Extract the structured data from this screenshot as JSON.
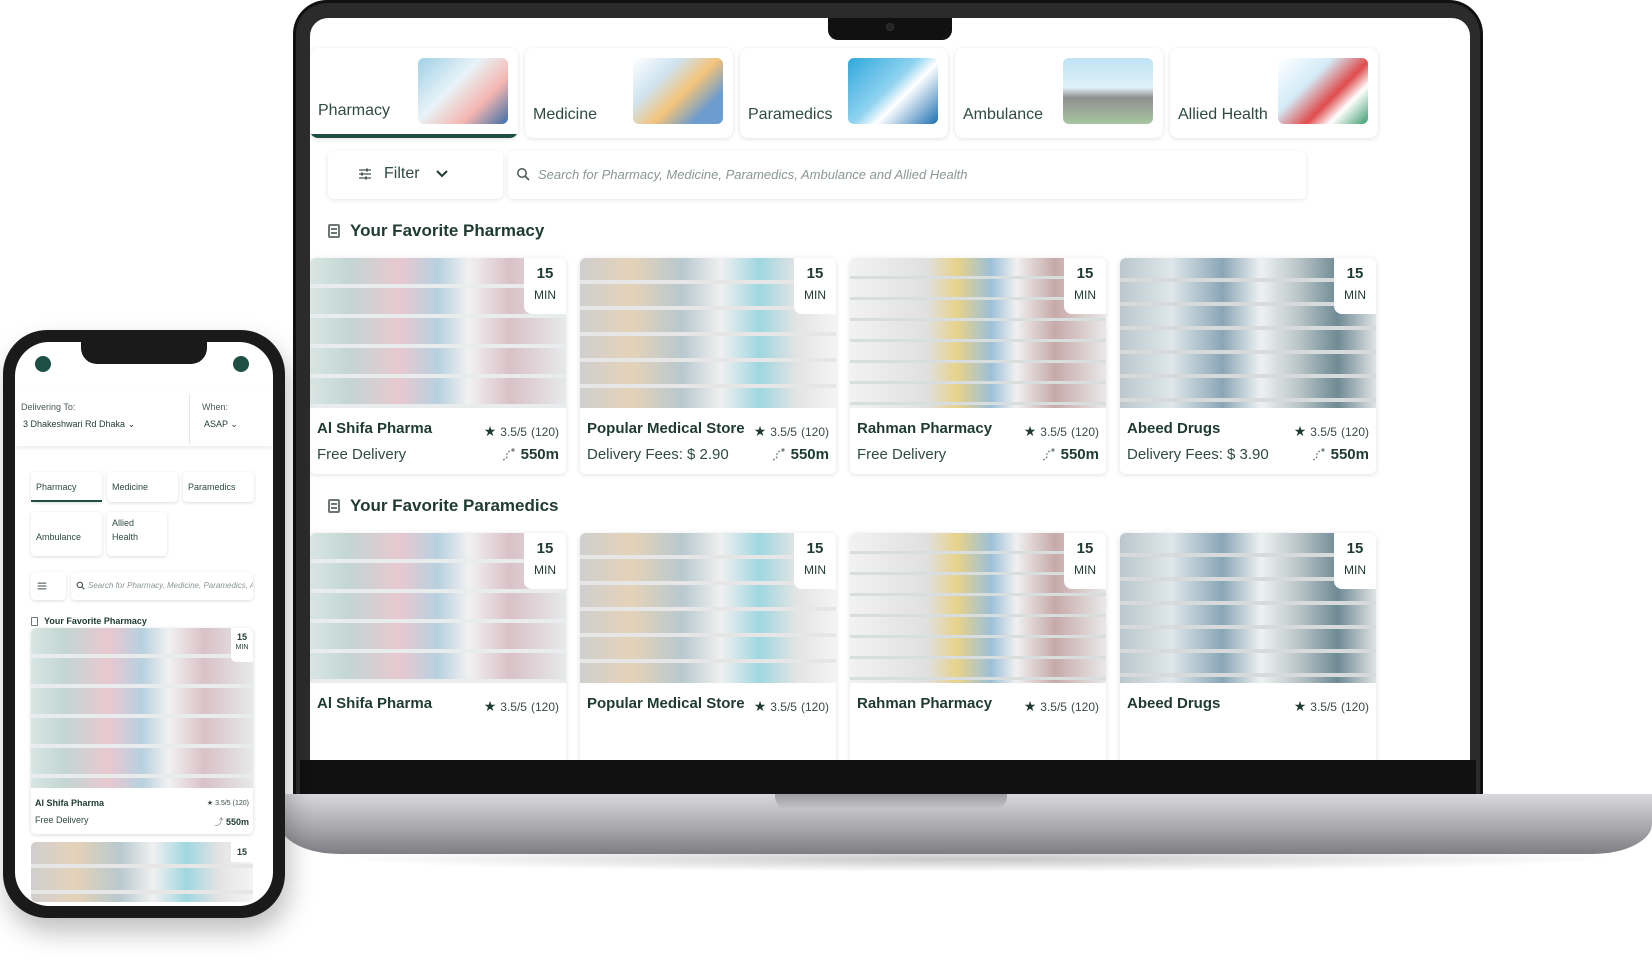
{
  "desktop": {
    "categories": [
      {
        "label": "Pharmacy",
        "active": true
      },
      {
        "label": "Medicine",
        "active": false
      },
      {
        "label": "Paramedics",
        "active": false
      },
      {
        "label": "Ambulance",
        "active": false
      },
      {
        "label": "Allied Health",
        "active": false
      }
    ],
    "filter_label": "Filter",
    "search_placeholder": "Search for Pharmacy, Medicine, Paramedics, Ambulance and Allied Health",
    "sections": [
      {
        "title": "Your Favorite Pharmacy",
        "cards": [
          {
            "name": "Al Shifa Pharma",
            "time": "15",
            "time_unit": "MIN",
            "rating": "3.5/5",
            "reviews": "(120)",
            "delivery": "Free Delivery",
            "distance": "550m"
          },
          {
            "name": "Popular Medical Store",
            "time": "15",
            "time_unit": "MIN",
            "rating": "3.5/5",
            "reviews": "(120)",
            "delivery": "Delivery Fees: $ 2.90",
            "distance": "550m"
          },
          {
            "name": "Rahman Pharmacy",
            "time": "15",
            "time_unit": "MIN",
            "rating": "3.5/5",
            "reviews": "(120)",
            "delivery": "Free Delivery",
            "distance": "550m"
          },
          {
            "name": "Abeed Drugs",
            "time": "15",
            "time_unit": "MIN",
            "rating": "3.5/5",
            "reviews": "(120)",
            "delivery": "Delivery Fees: $ 3.90",
            "distance": "550m"
          }
        ]
      },
      {
        "title": "Your Favorite Paramedics",
        "cards": [
          {
            "name": "Al Shifa Pharma",
            "time": "15",
            "time_unit": "MIN",
            "rating": "3.5/5",
            "reviews": "(120)"
          },
          {
            "name": "Popular Medical Store",
            "time": "15",
            "time_unit": "MIN",
            "rating": "3.5/5",
            "reviews": "(120)"
          },
          {
            "name": "Rahman Pharmacy",
            "time": "15",
            "time_unit": "MIN",
            "rating": "3.5/5",
            "reviews": "(120)"
          },
          {
            "name": "Abeed Drugs",
            "time": "15",
            "time_unit": "MIN",
            "rating": "3.5/5",
            "reviews": "(120)"
          }
        ]
      }
    ]
  },
  "mobile": {
    "delivering_label": "Delivering To:",
    "address": "3 Dhakeshwari Rd Dhaka",
    "when_label": "When:",
    "when_value": "ASAP",
    "categories": [
      "Pharmacy",
      "Medicine",
      "Paramedics",
      "Ambulance",
      "Allied Health"
    ],
    "search_placeholder": "Search for Pharmacy, Medicine, Paramedics, Amb",
    "section_title": "Your Favorite Pharmacy",
    "card": {
      "name": "Al Shifa Pharma",
      "time": "15",
      "time_unit": "MIN",
      "rating": "3.5/5",
      "reviews": "(120)",
      "delivery": "Free Delivery",
      "distance": "550m"
    },
    "next_card_time": "15"
  },
  "colors": {
    "accent": "#1e4f44",
    "text": "#1f3a33",
    "muted": "#8b9794"
  }
}
